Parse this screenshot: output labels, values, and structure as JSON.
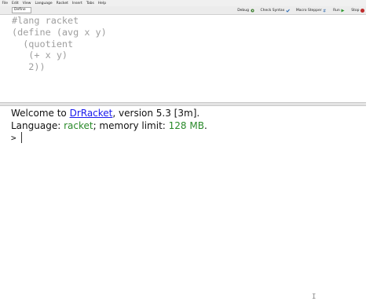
{
  "menubar": {
    "items": [
      "File",
      "Edit",
      "View",
      "Language",
      "Racket",
      "Insert",
      "Tabs",
      "Help"
    ]
  },
  "toolbar": {
    "definitions_label": "Define",
    "debug_label": "Debug",
    "check_syntax_label": "Check Syntax",
    "macro_stepper_label": "Macro Stepper",
    "run_label": "Run",
    "stop_label": "Stop",
    "colors": {
      "debug": "#3a7d2c",
      "check": "#2f6db5",
      "stepper": "#3a6fb0",
      "run": "#2e9a2e",
      "stop": "#c03030"
    }
  },
  "definitions": {
    "code": "#lang racket\n(define (avg x y)\n  (quotient\n   (+ x y)\n   2))"
  },
  "interactions": {
    "welcome_prefix": "Welcome to ",
    "app_link": "DrRacket",
    "welcome_suffix": ", version 5.3 [3m].",
    "language_prefix": "Language: ",
    "language_name": "racket",
    "memory_prefix": "; memory limit: ",
    "memory_limit": "128 MB",
    "memory_suffix": ".",
    "prompt": ">"
  }
}
